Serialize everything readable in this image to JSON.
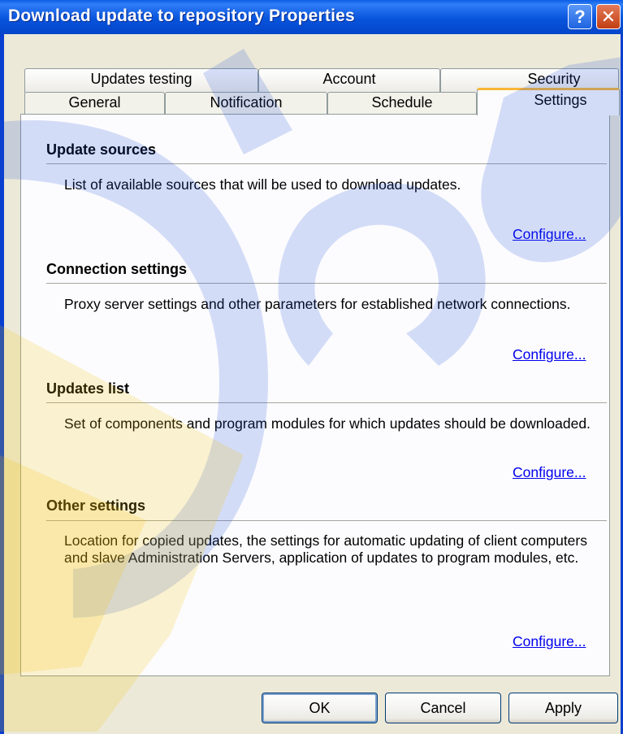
{
  "window": {
    "title": "Download update to repository Properties",
    "help_glyph": "?",
    "close_glyph": "✕"
  },
  "tabs": {
    "row1": [
      "Updates testing",
      "Account",
      "Security"
    ],
    "row2": [
      "General",
      "Notification",
      "Schedule",
      "Settings"
    ],
    "active": "Settings"
  },
  "sections": [
    {
      "title": "Update sources",
      "description": "List of available sources that will be used to download updates.",
      "link": "Configure..."
    },
    {
      "title": "Connection settings",
      "description": "Proxy server settings and other parameters for established network connections.",
      "link": "Configure..."
    },
    {
      "title": "Updates list",
      "description": "Set of components and program modules for which updates should be downloaded.",
      "link": "Configure..."
    },
    {
      "title": "Other settings",
      "description": "Location for copied updates, the settings for automatic updating of client computers and slave Administration Servers, application of updates to program modules, etc.",
      "link": "Configure..."
    }
  ],
  "buttons": {
    "ok": "OK",
    "cancel": "Cancel",
    "apply": "Apply"
  },
  "colors": {
    "titlebar": "#0854DD",
    "dialog_bg": "#ECE9D8",
    "link": "#0000EE",
    "active_tab_accent": "#F8B637"
  }
}
